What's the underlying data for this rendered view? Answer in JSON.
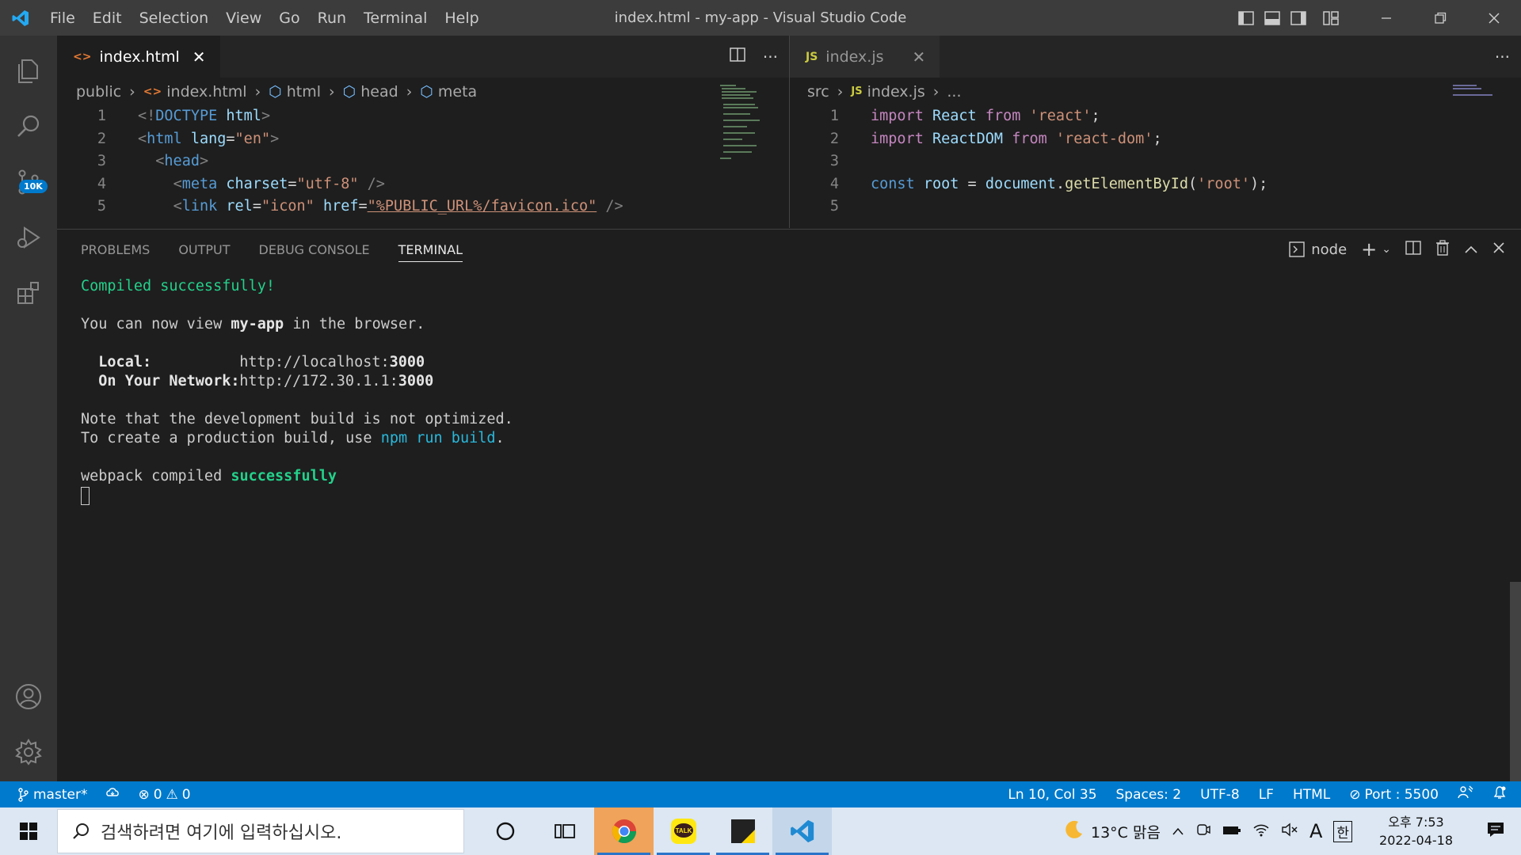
{
  "window": {
    "title": "index.html - my-app - Visual Studio Code"
  },
  "menu": [
    "File",
    "Edit",
    "Selection",
    "View",
    "Go",
    "Run",
    "Terminal",
    "Help"
  ],
  "activity": {
    "source_control_badge": "10K"
  },
  "left_editor": {
    "tab_label": "index.html",
    "breadcrumb": [
      "public",
      "index.html",
      "html",
      "head",
      "meta"
    ],
    "lines": [
      {
        "n": "1",
        "parts": [
          [
            "t",
            "<!"
          ],
          [
            "k",
            "DOCTYPE"
          ],
          [
            "w",
            " "
          ],
          [
            "a",
            "html"
          ],
          [
            "t",
            ">"
          ]
        ]
      },
      {
        "n": "2",
        "parts": [
          [
            "t",
            "<"
          ],
          [
            "k",
            "html"
          ],
          [
            "w",
            " "
          ],
          [
            "a",
            "lang"
          ],
          [
            "w",
            "="
          ],
          [
            "s",
            "\"en\""
          ],
          [
            "t",
            ">"
          ]
        ]
      },
      {
        "n": "3",
        "parts": [
          [
            "w",
            "  "
          ],
          [
            "t",
            "<"
          ],
          [
            "k",
            "head"
          ],
          [
            "t",
            ">"
          ]
        ]
      },
      {
        "n": "4",
        "parts": [
          [
            "w",
            "    "
          ],
          [
            "t",
            "<"
          ],
          [
            "k",
            "meta"
          ],
          [
            "w",
            " "
          ],
          [
            "a",
            "charset"
          ],
          [
            "w",
            "="
          ],
          [
            "s",
            "\"utf-8\""
          ],
          [
            "w",
            " "
          ],
          [
            "t",
            "/>"
          ]
        ]
      },
      {
        "n": "5",
        "parts": [
          [
            "w",
            "    "
          ],
          [
            "t",
            "<"
          ],
          [
            "k",
            "link"
          ],
          [
            "w",
            " "
          ],
          [
            "a",
            "rel"
          ],
          [
            "w",
            "="
          ],
          [
            "s",
            "\"icon\""
          ],
          [
            "w",
            " "
          ],
          [
            "a",
            "href"
          ],
          [
            "w",
            "="
          ],
          [
            "s",
            "\"%PUBLIC_URL%/favicon.ico\""
          ],
          [
            "w",
            " "
          ],
          [
            "t",
            "/>"
          ]
        ]
      }
    ]
  },
  "right_editor": {
    "tab_label": "index.js",
    "breadcrumb": [
      "src",
      "index.js",
      "..."
    ],
    "lines": [
      {
        "n": "1",
        "parts": [
          [
            "kw",
            "import"
          ],
          [
            "w",
            " "
          ],
          [
            "v",
            "React"
          ],
          [
            "w",
            " "
          ],
          [
            "kw",
            "from"
          ],
          [
            "w",
            " "
          ],
          [
            "s",
            "'react'"
          ],
          [
            "w",
            ";"
          ]
        ]
      },
      {
        "n": "2",
        "parts": [
          [
            "kw",
            "import"
          ],
          [
            "w",
            " "
          ],
          [
            "v",
            "ReactDOM"
          ],
          [
            "w",
            " "
          ],
          [
            "kw",
            "from"
          ],
          [
            "w",
            " "
          ],
          [
            "s",
            "'react-dom'"
          ],
          [
            "w",
            ";"
          ]
        ]
      },
      {
        "n": "3",
        "parts": []
      },
      {
        "n": "4",
        "parts": [
          [
            "k",
            "const"
          ],
          [
            "w",
            " "
          ],
          [
            "v",
            "root"
          ],
          [
            "w",
            " = "
          ],
          [
            "v",
            "document"
          ],
          [
            "w",
            "."
          ],
          [
            "f",
            "getElementById"
          ],
          [
            "w",
            "("
          ],
          [
            "s",
            "'root'"
          ],
          [
            "w",
            ");"
          ]
        ]
      },
      {
        "n": "5",
        "parts": []
      }
    ]
  },
  "panel": {
    "tabs": [
      "PROBLEMS",
      "OUTPUT",
      "DEBUG CONSOLE",
      "TERMINAL"
    ],
    "active_tab": "TERMINAL",
    "shell": "node",
    "terminal": {
      "compiled": "Compiled successfully!",
      "view_pre": "You can now view ",
      "app": "my-app",
      "view_post": " in the browser.",
      "local_label": "Local:",
      "local_url": "http://localhost:",
      "local_port": "3000",
      "network_label": "On Your Network:",
      "network_url": "http://172.30.1.1:",
      "network_port": "3000",
      "note1": "Note that the development build is not optimized.",
      "note2_pre": "To create a production build, use ",
      "note2_cmd": "npm run build",
      "note2_post": ".",
      "webpack_pre": "webpack compiled ",
      "webpack_status": "successfully"
    }
  },
  "status": {
    "branch": "master*",
    "errors": "0",
    "warnings": "0",
    "position": "Ln 10, Col 35",
    "spaces": "Spaces: 2",
    "encoding": "UTF-8",
    "eol": "LF",
    "language": "HTML",
    "port": "Port : 5500"
  },
  "taskbar": {
    "search_placeholder": "검색하려면 여기에 입력하십시오.",
    "weather": "13°C 맑음",
    "ime": "A",
    "lang": "한",
    "time": "오후 7:53",
    "date": "2022-04-18"
  },
  "colors": {
    "accent": "#007acc",
    "tag": "#808080",
    "keyword": "#569cd6",
    "attr": "#9cdcfe",
    "string": "#ce9178",
    "control": "#c586c0",
    "function": "#dcdcaa",
    "terminal_green": "#23d18b"
  }
}
